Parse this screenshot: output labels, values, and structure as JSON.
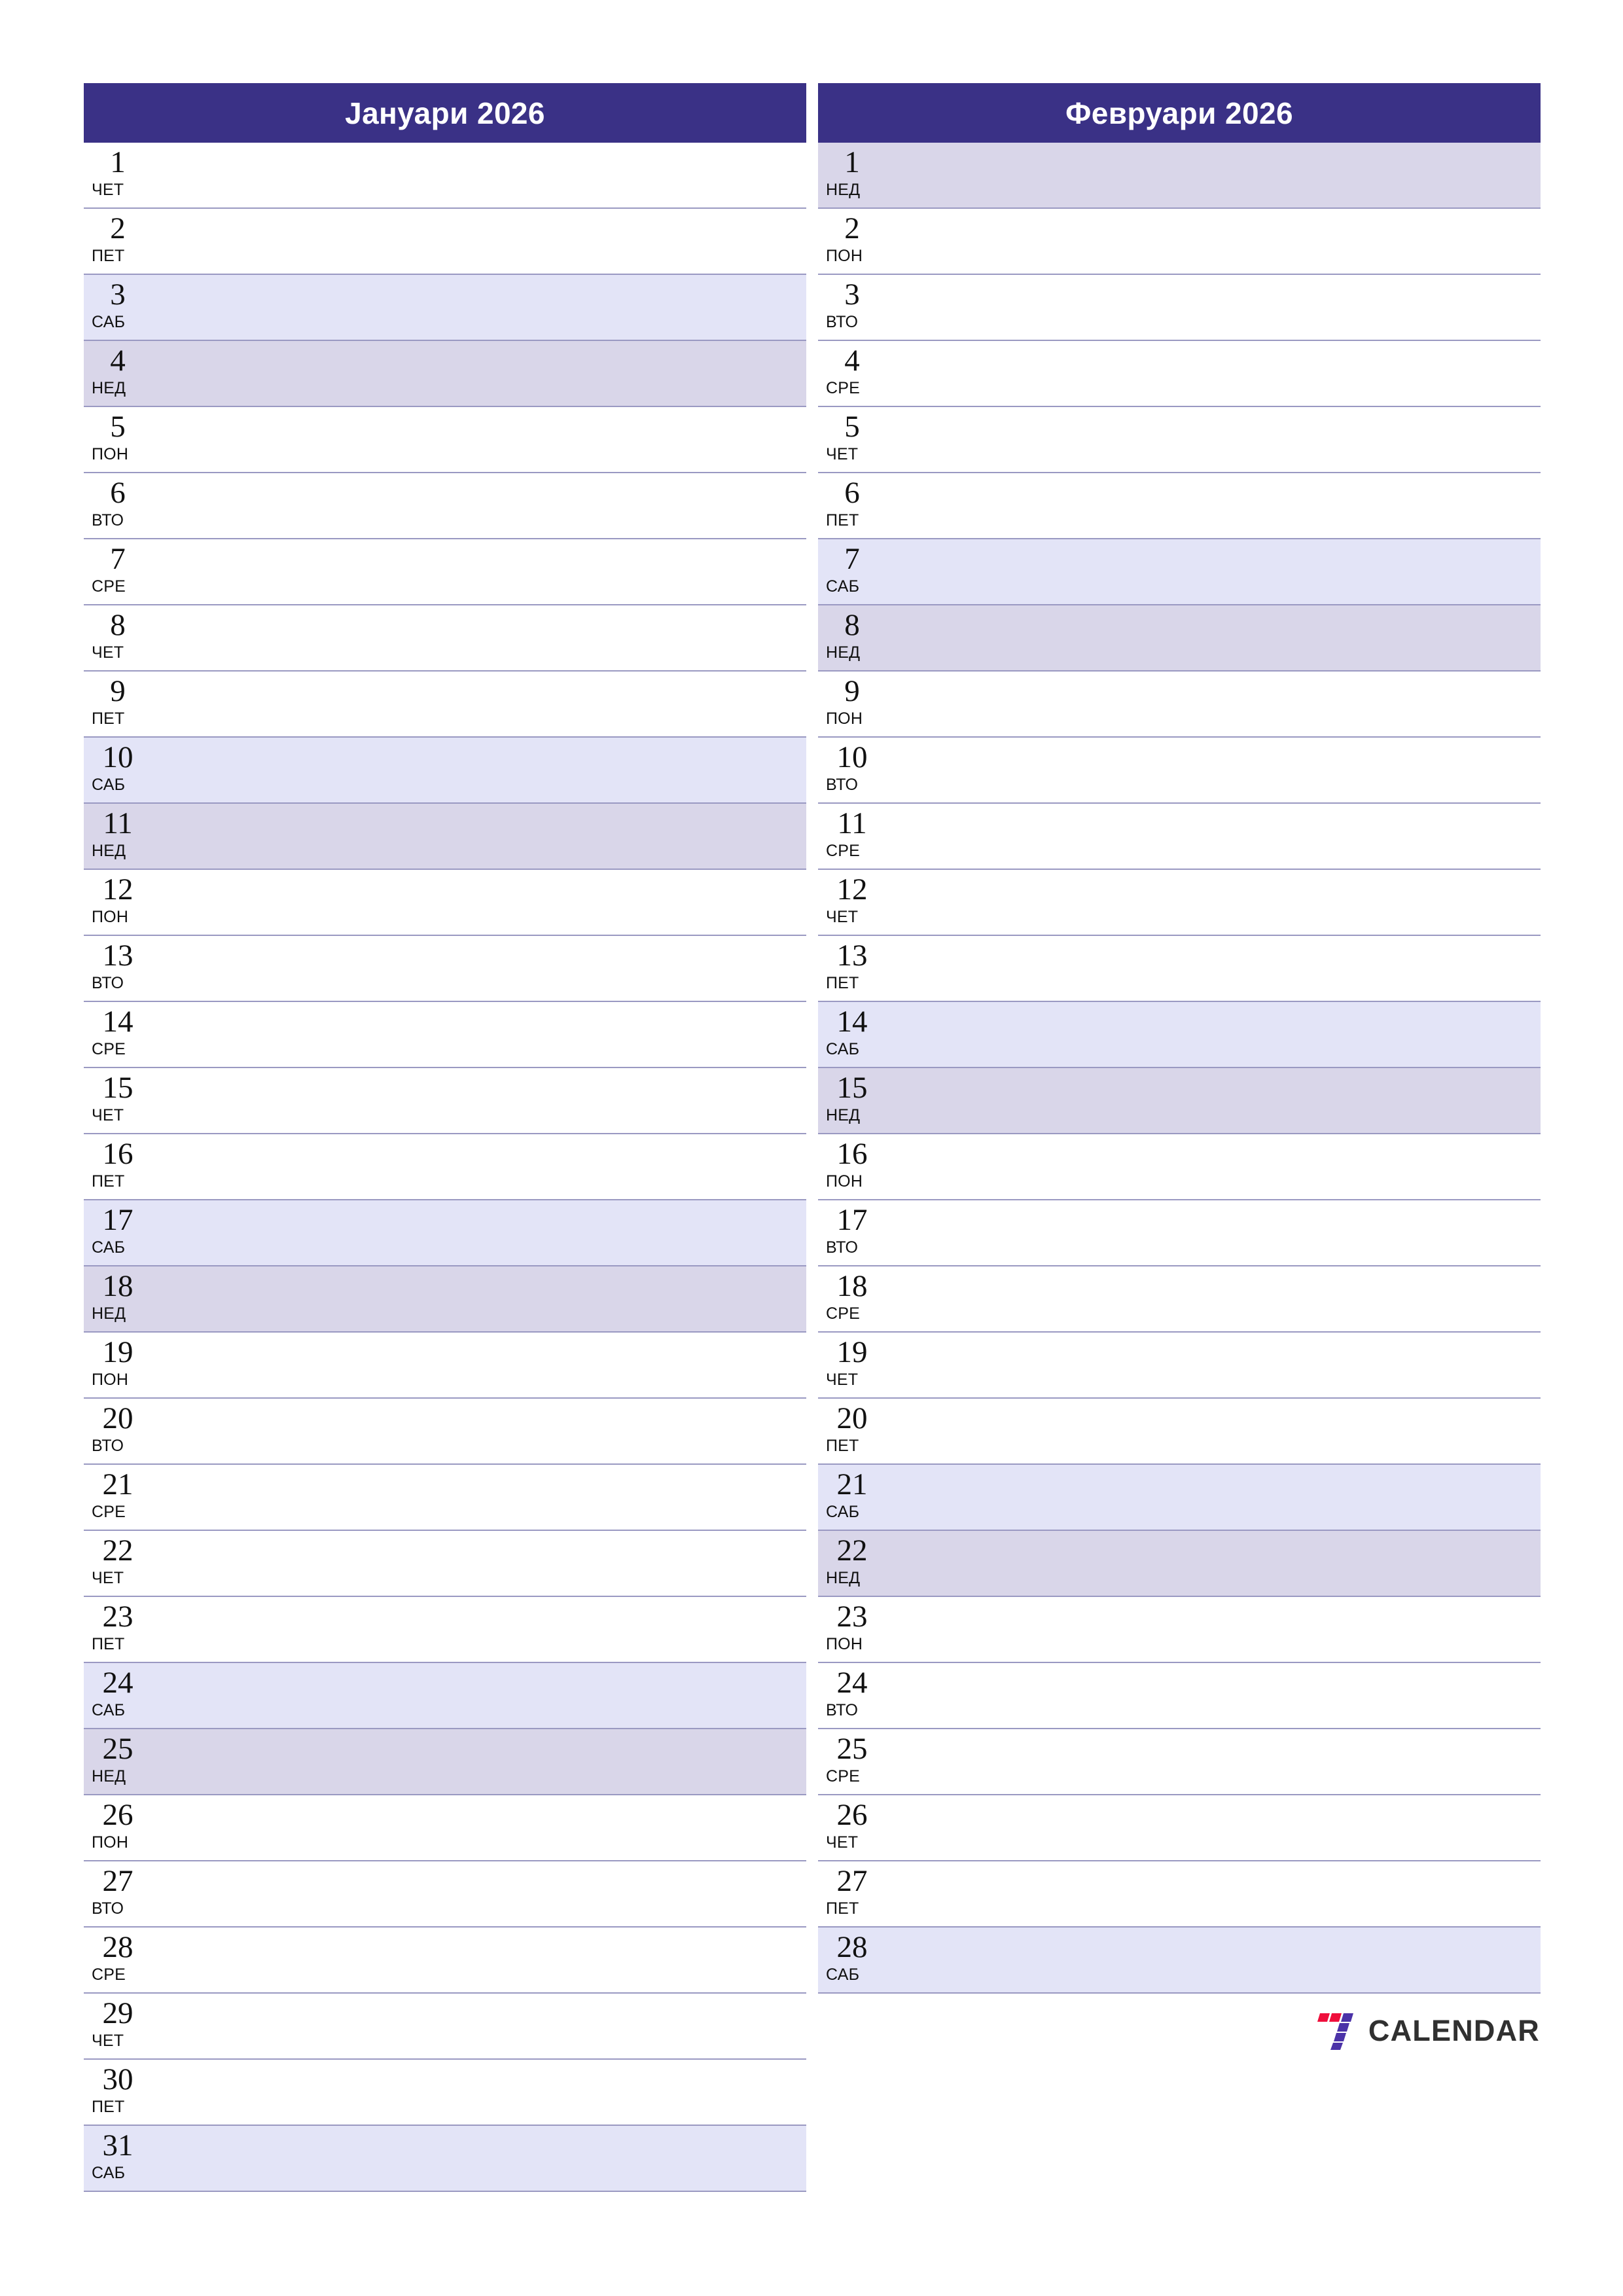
{
  "page": {
    "background": "#ffffff",
    "accent_header": "#3a3186",
    "saturday_tint": "#e3e4f7",
    "sunday_tint": "#d9d6e9",
    "rule_color": "#9a99c2"
  },
  "months": [
    {
      "title": "Јануари 2026",
      "days": [
        {
          "num": "1",
          "dow": "ЧЕТ",
          "type": "weekday"
        },
        {
          "num": "2",
          "dow": "ПЕТ",
          "type": "weekday"
        },
        {
          "num": "3",
          "dow": "САБ",
          "type": "sat"
        },
        {
          "num": "4",
          "dow": "НЕД",
          "type": "sun"
        },
        {
          "num": "5",
          "dow": "ПОН",
          "type": "weekday"
        },
        {
          "num": "6",
          "dow": "ВТО",
          "type": "weekday"
        },
        {
          "num": "7",
          "dow": "СРЕ",
          "type": "weekday"
        },
        {
          "num": "8",
          "dow": "ЧЕТ",
          "type": "weekday"
        },
        {
          "num": "9",
          "dow": "ПЕТ",
          "type": "weekday"
        },
        {
          "num": "10",
          "dow": "САБ",
          "type": "sat"
        },
        {
          "num": "11",
          "dow": "НЕД",
          "type": "sun"
        },
        {
          "num": "12",
          "dow": "ПОН",
          "type": "weekday"
        },
        {
          "num": "13",
          "dow": "ВТО",
          "type": "weekday"
        },
        {
          "num": "14",
          "dow": "СРЕ",
          "type": "weekday"
        },
        {
          "num": "15",
          "dow": "ЧЕТ",
          "type": "weekday"
        },
        {
          "num": "16",
          "dow": "ПЕТ",
          "type": "weekday"
        },
        {
          "num": "17",
          "dow": "САБ",
          "type": "sat"
        },
        {
          "num": "18",
          "dow": "НЕД",
          "type": "sun"
        },
        {
          "num": "19",
          "dow": "ПОН",
          "type": "weekday"
        },
        {
          "num": "20",
          "dow": "ВТО",
          "type": "weekday"
        },
        {
          "num": "21",
          "dow": "СРЕ",
          "type": "weekday"
        },
        {
          "num": "22",
          "dow": "ЧЕТ",
          "type": "weekday"
        },
        {
          "num": "23",
          "dow": "ПЕТ",
          "type": "weekday"
        },
        {
          "num": "24",
          "dow": "САБ",
          "type": "sat"
        },
        {
          "num": "25",
          "dow": "НЕД",
          "type": "sun"
        },
        {
          "num": "26",
          "dow": "ПОН",
          "type": "weekday"
        },
        {
          "num": "27",
          "dow": "ВТО",
          "type": "weekday"
        },
        {
          "num": "28",
          "dow": "СРЕ",
          "type": "weekday"
        },
        {
          "num": "29",
          "dow": "ЧЕТ",
          "type": "weekday"
        },
        {
          "num": "30",
          "dow": "ПЕТ",
          "type": "weekday"
        },
        {
          "num": "31",
          "dow": "САБ",
          "type": "sat"
        }
      ]
    },
    {
      "title": "Февруари 2026",
      "days": [
        {
          "num": "1",
          "dow": "НЕД",
          "type": "sun"
        },
        {
          "num": "2",
          "dow": "ПОН",
          "type": "weekday"
        },
        {
          "num": "3",
          "dow": "ВТО",
          "type": "weekday"
        },
        {
          "num": "4",
          "dow": "СРЕ",
          "type": "weekday"
        },
        {
          "num": "5",
          "dow": "ЧЕТ",
          "type": "weekday"
        },
        {
          "num": "6",
          "dow": "ПЕТ",
          "type": "weekday"
        },
        {
          "num": "7",
          "dow": "САБ",
          "type": "sat"
        },
        {
          "num": "8",
          "dow": "НЕД",
          "type": "sun"
        },
        {
          "num": "9",
          "dow": "ПОН",
          "type": "weekday"
        },
        {
          "num": "10",
          "dow": "ВТО",
          "type": "weekday"
        },
        {
          "num": "11",
          "dow": "СРЕ",
          "type": "weekday"
        },
        {
          "num": "12",
          "dow": "ЧЕТ",
          "type": "weekday"
        },
        {
          "num": "13",
          "dow": "ПЕТ",
          "type": "weekday"
        },
        {
          "num": "14",
          "dow": "САБ",
          "type": "sat"
        },
        {
          "num": "15",
          "dow": "НЕД",
          "type": "sun"
        },
        {
          "num": "16",
          "dow": "ПОН",
          "type": "weekday"
        },
        {
          "num": "17",
          "dow": "ВТО",
          "type": "weekday"
        },
        {
          "num": "18",
          "dow": "СРЕ",
          "type": "weekday"
        },
        {
          "num": "19",
          "dow": "ЧЕТ",
          "type": "weekday"
        },
        {
          "num": "20",
          "dow": "ПЕТ",
          "type": "weekday"
        },
        {
          "num": "21",
          "dow": "САБ",
          "type": "sat"
        },
        {
          "num": "22",
          "dow": "НЕД",
          "type": "sun"
        },
        {
          "num": "23",
          "dow": "ПОН",
          "type": "weekday"
        },
        {
          "num": "24",
          "dow": "ВТО",
          "type": "weekday"
        },
        {
          "num": "25",
          "dow": "СРЕ",
          "type": "weekday"
        },
        {
          "num": "26",
          "dow": "ЧЕТ",
          "type": "weekday"
        },
        {
          "num": "27",
          "dow": "ПЕТ",
          "type": "weekday"
        },
        {
          "num": "28",
          "dow": "САБ",
          "type": "sat"
        }
      ]
    }
  ],
  "brand": {
    "text": "CALENDAR",
    "mark_name": "seven-logo-icon",
    "mark_color_red": "#ef0f3c",
    "mark_color_purple": "#4b32a8",
    "text_color": "#303030"
  }
}
